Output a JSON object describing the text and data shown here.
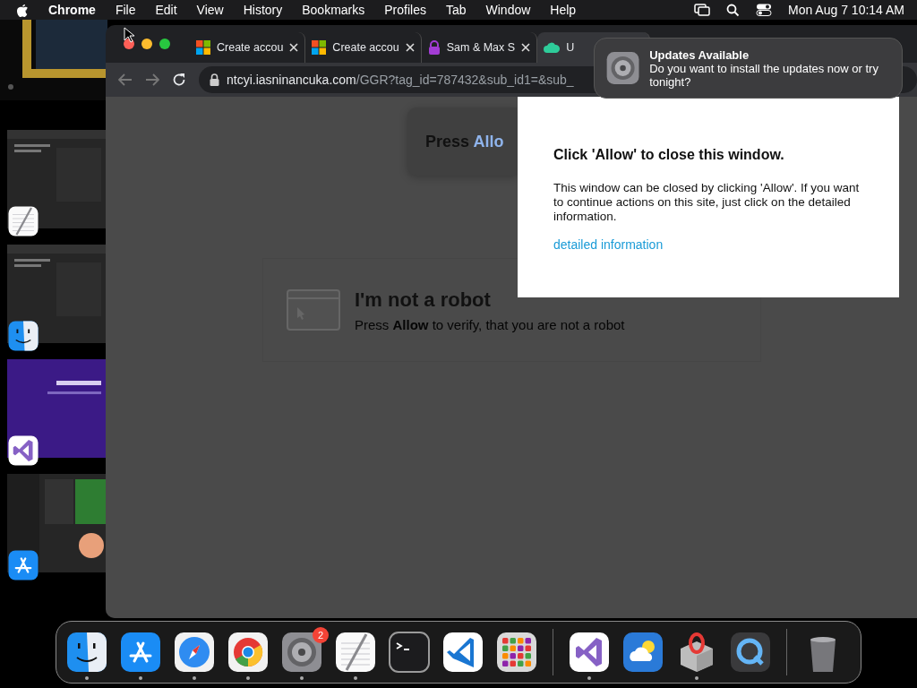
{
  "menu_bar": {
    "app_name": "Chrome",
    "menus": [
      "File",
      "Edit",
      "View",
      "History",
      "Bookmarks",
      "Profiles",
      "Tab",
      "Window",
      "Help"
    ],
    "clock": "Mon Aug 7  10:14 AM"
  },
  "stage_manager": [
    {
      "kind": "textedit"
    },
    {
      "kind": "finder"
    },
    {
      "kind": "visualstudio"
    },
    {
      "kind": "appstore"
    }
  ],
  "browser": {
    "tabs": [
      {
        "title": "Create accou",
        "kind": "microsoft",
        "selected": false,
        "close_button": true
      },
      {
        "title": "Create accou",
        "kind": "microsoft",
        "selected": false,
        "close_button": true
      },
      {
        "title": "Sam & Max S",
        "kind": "lock",
        "selected": false,
        "close_button": true
      },
      {
        "title": "U",
        "kind": "cloud",
        "selected": true,
        "close_button": false
      }
    ],
    "url": {
      "host": "ntcyi.iasninancuka.com",
      "path": "/GGR?tag_id=787432&sub_id1=&sub_"
    },
    "page": {
      "prompt": {
        "text": "Press",
        "highlight": "Allo"
      },
      "robot": {
        "title": "I'm not a robot",
        "subtitle": "Press **Allow** to verify, that you are not a robot"
      },
      "popup": {
        "heading": "Click 'Allow' to close this window.",
        "body": "This window can be closed by clicking 'Allow'. If you want to continue actions on this site, just click on the detailed information.",
        "link": "detailed information"
      }
    }
  },
  "notification": {
    "title": "Updates Available",
    "body": "Do you want to install the updates now or try tonight?"
  },
  "dock": {
    "apps": [
      {
        "kind": "finder",
        "running": true
      },
      {
        "kind": "appstore",
        "running": true
      },
      {
        "kind": "safari",
        "running": true
      },
      {
        "kind": "chrome",
        "running": true
      },
      {
        "kind": "settings",
        "running": true,
        "badge": "2"
      },
      {
        "kind": "textedit",
        "running": true
      },
      {
        "kind": "terminal",
        "running": false
      },
      {
        "kind": "vscode",
        "running": false
      },
      {
        "kind": "launchpad",
        "running": false
      }
    ],
    "recent": [
      {
        "kind": "visualstudio",
        "running": true
      },
      {
        "kind": "weather",
        "running": false
      },
      {
        "kind": "package",
        "running": true
      },
      {
        "kind": "quicktime",
        "running": false
      }
    ],
    "trash": {
      "kind": "trash",
      "running": false
    }
  }
}
